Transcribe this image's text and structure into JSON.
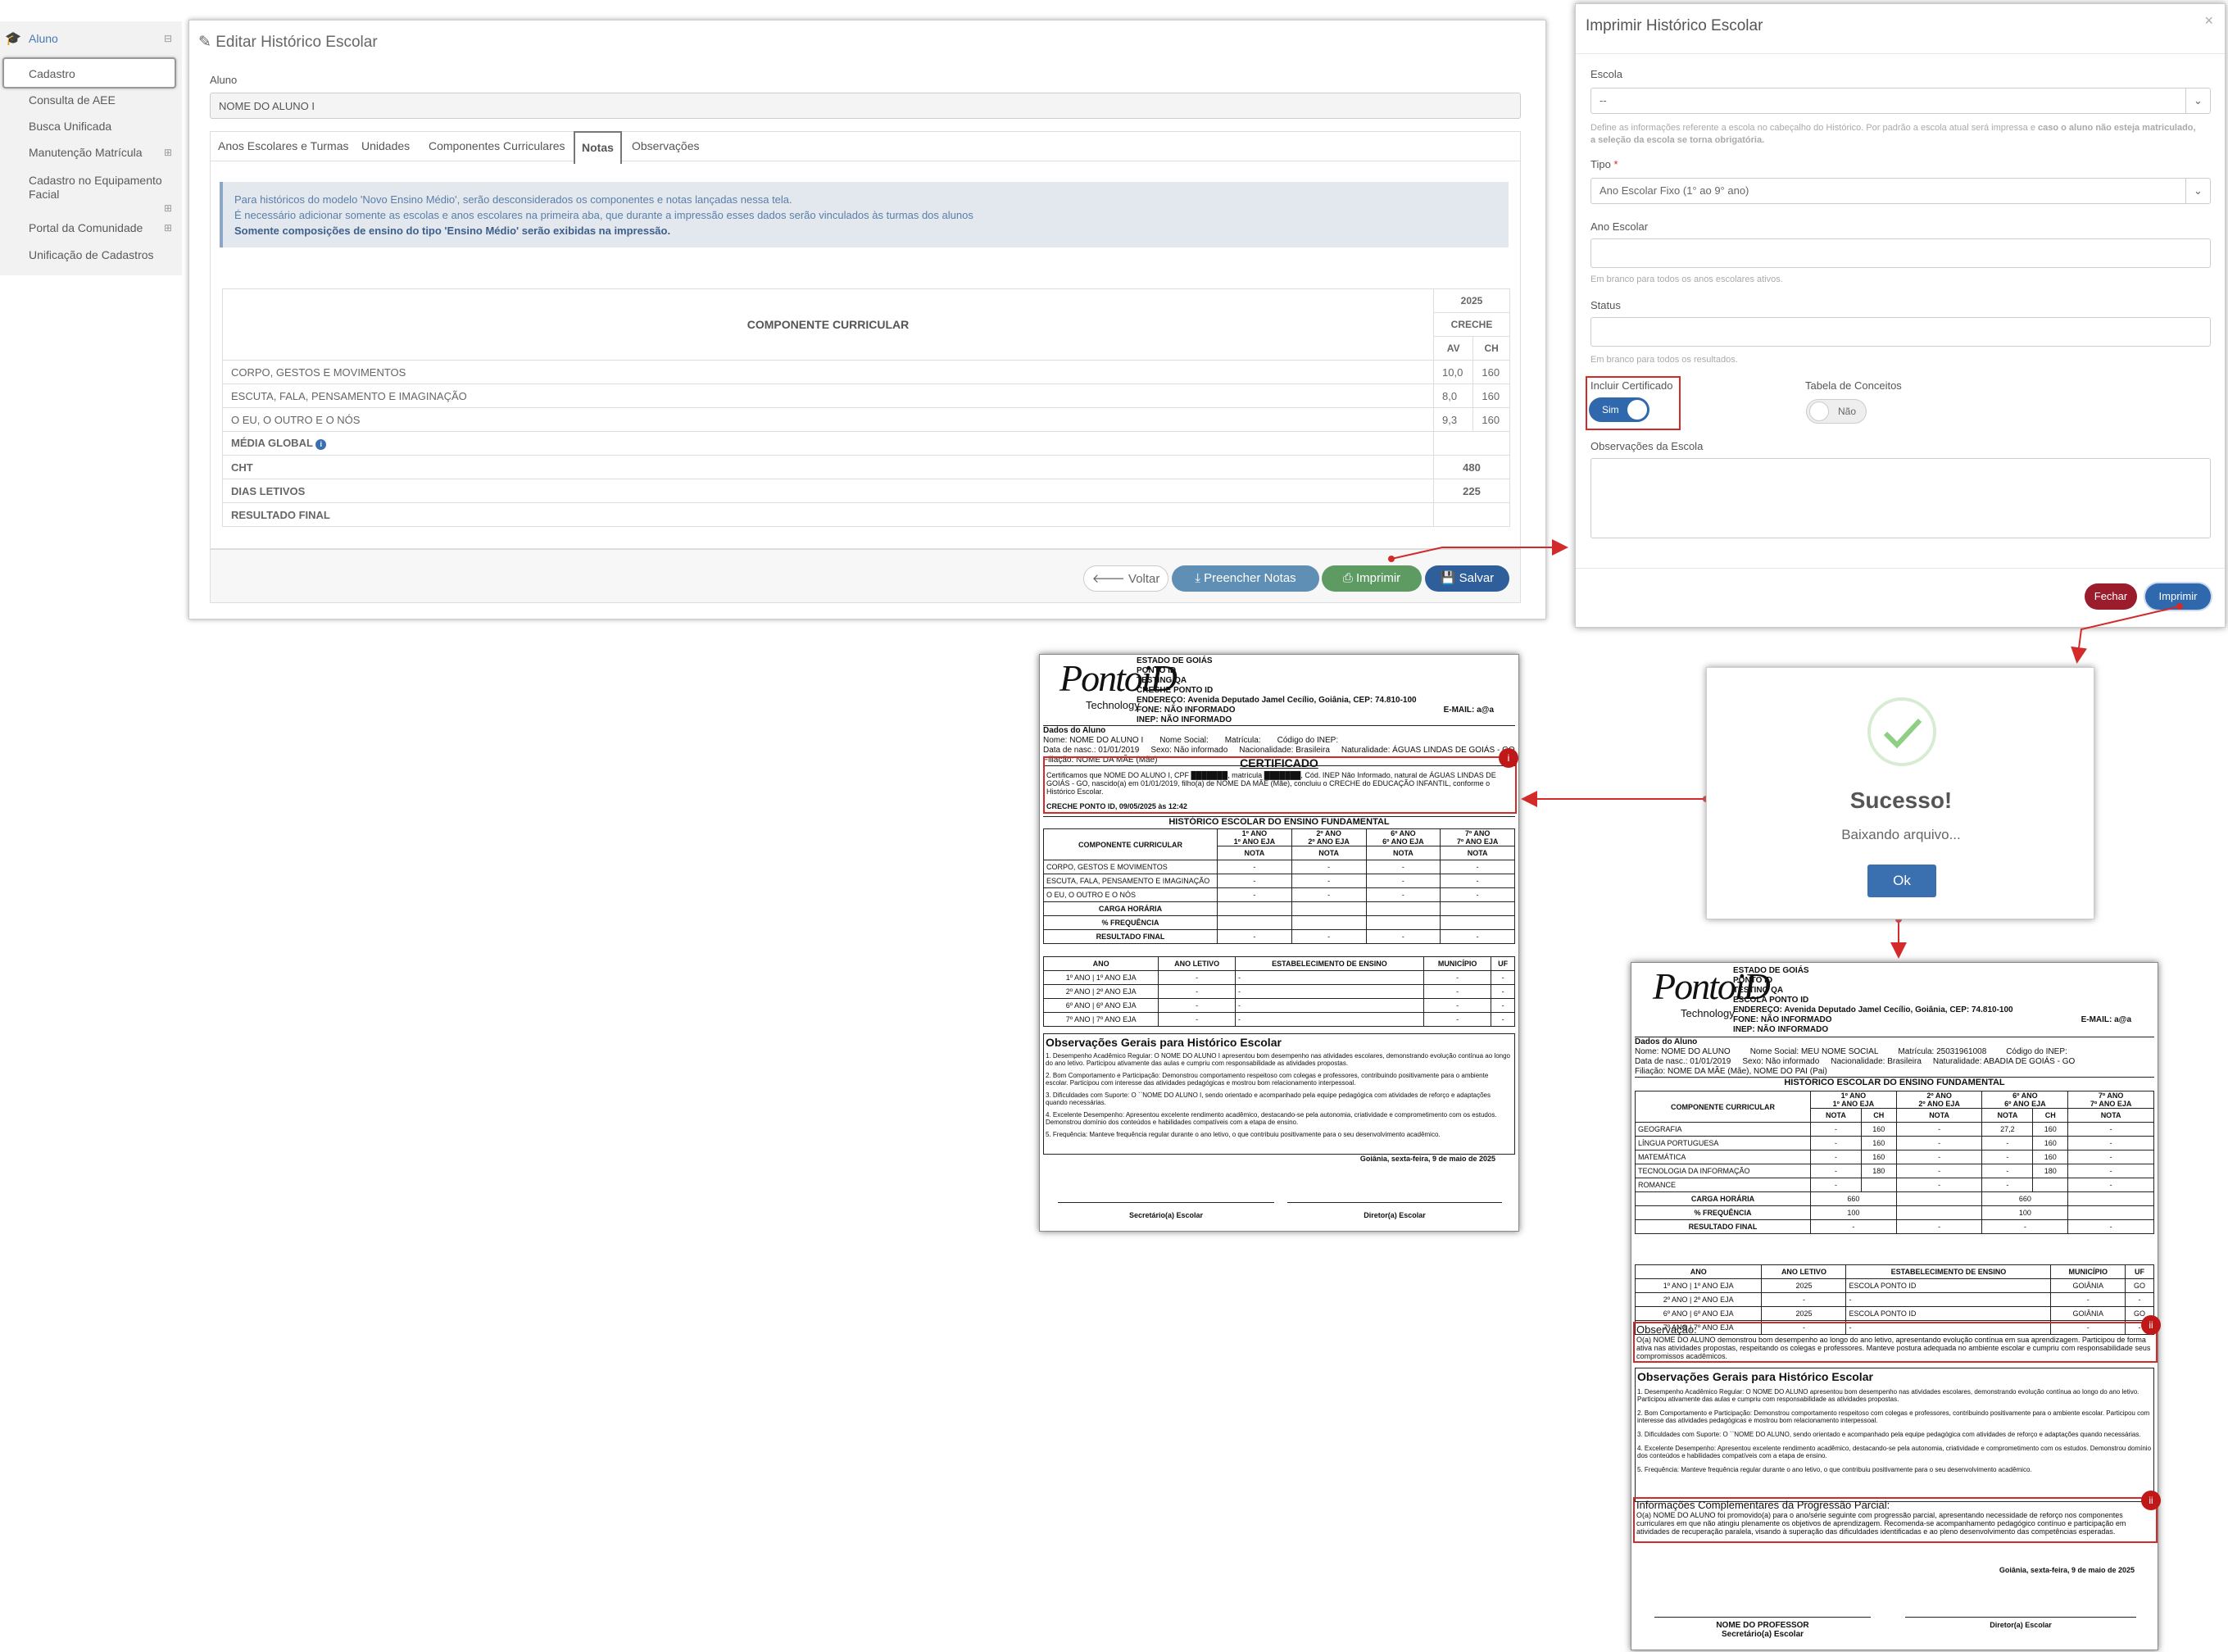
{
  "sidebar": {
    "header": "Aluno",
    "items": [
      "Cadastro",
      "Consulta de AEE",
      "Busca Unificada",
      "Manutenção Matrícula",
      "Cadastro no Equipamento Facial",
      "Portal da Comunidade",
      "Unificação de Cadastros"
    ]
  },
  "main": {
    "title": "Editar Histórico Escolar",
    "aluno_label": "Aluno",
    "aluno_value": "NOME DO ALUNO I",
    "tabs": [
      "Anos Escolares e Turmas",
      "Unidades",
      "Componentes Curriculares",
      "Notas",
      "Observações"
    ],
    "info": [
      "Para históricos do modelo 'Novo Ensino Médio', serão desconsiderados os componentes e notas lançadas nessa tela.",
      "É necessário adicionar somente as escolas e anos escolares na primeira aba, que durante a impressão esses dados serão vinculados às turmas dos alunos",
      "Somente composições de ensino do tipo 'Ensino Médio' serão exibidas na impressão."
    ],
    "table": {
      "comp_header": "COMPONENTE CURRICULAR",
      "year": "2025",
      "level": "CRECHE",
      "av": "AV",
      "ch": "CH",
      "rows": [
        {
          "name": "CORPO, GESTOS E MOVIMENTOS",
          "av": "10,0",
          "ch": "160"
        },
        {
          "name": "ESCUTA, FALA, PENSAMENTO E IMAGINAÇÃO",
          "av": "8,0",
          "ch": "160"
        },
        {
          "name": "O EU, O OUTRO E O NÓS",
          "av": "9,3",
          "ch": "160"
        }
      ],
      "media": "MÉDIA GLOBAL",
      "cht": "CHT",
      "cht_val": "480",
      "dias": "DIAS LETIVOS",
      "dias_val": "225",
      "resultado": "RESULTADO FINAL"
    },
    "buttons": {
      "voltar": "Voltar",
      "preencher": "Preencher Notas",
      "imprimir": "Imprimir",
      "salvar": "Salvar"
    }
  },
  "modal": {
    "title": "Imprimir Histórico Escolar",
    "escola_label": "Escola",
    "escola_value": "--",
    "escola_hint_a": "Define as informações referente a escola no cabeçalho do Histórico. Por padrão a escola atual será impressa e ",
    "escola_hint_b": "caso o aluno não esteja matriculado, a seleção da escola se torna obrigatória.",
    "tipo_label": "Tipo",
    "tipo_value": "Ano Escolar Fixo (1° ao 9° ano)",
    "ano_label": "Ano Escolar",
    "ano_hint": "Em branco para todos os anos escolares ativos.",
    "status_label": "Status",
    "status_hint": "Em branco para todos os resultados.",
    "cert_label": "Incluir Certificado",
    "cert_value": "Sim",
    "conceitos_label": "Tabela de Conceitos",
    "conceitos_value": "Não",
    "obs_label": "Observações da Escola",
    "fechar": "Fechar",
    "imprimir": "Imprimir",
    "close": "×"
  },
  "success": {
    "title": "Sucesso!",
    "message": "Baixando arquivo...",
    "ok": "Ok"
  },
  "doc1": {
    "logo": "PontoiD",
    "logo_sub": "Technology",
    "header": [
      "ESTADO DE GOIÁS",
      "PONTO ID",
      "TESTING QA",
      "CRECHE PONTO ID",
      "ENDEREÇO: Avenida Deputado Jamel Cecílio, Goiânia, CEP: 74.810-100",
      "FONE: NÃO INFORMADO",
      "INEP: NÃO INFORMADO"
    ],
    "email": "E-MAIL: a@a",
    "dados": [
      "Dados do Aluno",
      "Nome: NOME DO ALUNO I",
      "Nome Social:",
      "Matrícula:",
      "Código do INEP:",
      "Data de nasc.: 01/01/2019",
      "Sexo: Não informado",
      "Nacionalidade: Brasileira",
      "Naturalidade: ÁGUAS LINDAS DE GOIÁS - GO",
      "Filiação: NOME DA MÃE (Mãe)"
    ],
    "cert_title": "CERTIFICADO",
    "cert_text": "Certificamos que NOME DO ALUNO I, CPF ███████, matrícula ███████, Cód. INEP Não Informado, natural de ÁGUAS LINDAS DE GOIÁS - GO, nascido(a) em 01/01/2019, filho(a) de NOME DA MÃE (Mãe), concluiu o CRECHE do EDUCAÇÃO INFANTIL, conforme o Histórico Escolar.",
    "cert_sign": "CRECHE PONTO ID, 09/05/2025 às 12:42",
    "hist_title": "HISTÓRICO ESCOLAR DO ENSINO FUNDAMENTAL",
    "comp": "COMPONENTE CURRICULAR",
    "cols": [
      "1º ANO\n1º ANO EJA",
      "2º ANO\n2º ANO EJA",
      "6º ANO\n6º ANO EJA",
      "7º ANO\n7º ANO EJA"
    ],
    "nota": "NOTA",
    "rows": [
      "CORPO, GESTOS E MOVIMENTOS",
      "ESCUTA, FALA, PENSAMENTO E IMAGINAÇÃO",
      "O EU, O OUTRO E O NÓS"
    ],
    "sum_rows": [
      "CARGA HORÁRIA",
      "% FREQUÊNCIA",
      "RESULTADO FINAL"
    ],
    "dash": "-",
    "anos_head": [
      "ANO",
      "ANO LETIVO",
      "ESTABELECIMENTO DE ENSINO",
      "MUNICÍPIO",
      "UF"
    ],
    "anos": [
      "1º ANO | 1º ANO EJA",
      "2º ANO | 2º ANO EJA",
      "6º ANO | 6º ANO EJA",
      "7º ANO | 7º ANO EJA"
    ],
    "obs_title": "Observações Gerais para Histórico Escolar",
    "obs": [
      "1. Desempenho Acadêmico Regular: O NOME DO ALUNO I apresentou bom desempenho nas atividades escolares, demonstrando evolução contínua ao longo do ano letivo. Participou ativamente das aulas e cumpriu com responsabilidade as atividades propostas.",
      "2. Bom Comportamento e Participação: Demonstrou comportamento respeitoso com colegas e professores, contribuindo positivamente para o ambiente escolar. Participou com interesse das atividades pedagógicas e mostrou bom relacionamento interpessoal.",
      "3. Dificuldades com Suporte: O ``NOME DO ALUNO I, sendo orientado e acompanhado pela equipe pedagógica com atividades de reforço e adaptações quando necessárias.",
      "4. Excelente Desempenho: Apresentou excelente rendimento acadêmico, destacando-se pela autonomia, criatividade e comprometimento com os estudos. Demonstrou domínio dos conteúdos e habilidades compatíveis com a etapa de ensino.",
      "5. Frequência: Manteve frequência regular durante o ano letivo, o que contribuiu positivamente para o seu desenvolvimento acadêmico."
    ],
    "date": "Goiânia, sexta-feira, 9 de maio de 2025",
    "sig1": "Secretário(a) Escolar",
    "sig2": "Diretor(a) Escolar",
    "badge": "i"
  },
  "doc2": {
    "logo": "PontoiD",
    "logo_sub": "Technology",
    "header": [
      "ESTADO DE GOIÁS",
      "PONTO ID",
      "TESTING QA",
      "ESCOLA PONTO ID",
      "ENDEREÇO: Avenida Deputado Jamel Cecílio, Goiânia, CEP: 74.810-100",
      "FONE: NÃO INFORMADO",
      "INEP: NÃO INFORMADO"
    ],
    "email": "E-MAIL: a@a",
    "dados": [
      "Dados do Aluno",
      "Nome: NOME DO ALUNO",
      "Nome Social: MEU NOME SOCIAL",
      "Matrícula: 25031961008",
      "Código do INEP:",
      "Data de nasc.: 01/01/2019",
      "Sexo: Não informado",
      "Nacionalidade: Brasileira",
      "Naturalidade: ABADIA DE GOIÁS - GO",
      "Filiação: NOME DA MÃE (Mãe), NOME DO PAI (Pai)"
    ],
    "hist_title": "HISTÓRICO ESCOLAR DO ENSINO FUNDAMENTAL",
    "comp": "COMPONENTE CURRICULAR",
    "cols": [
      "1º ANO\n1º ANO EJA",
      "2º ANO\n2º ANO EJA",
      "6º ANO\n6º ANO EJA",
      "7º ANO\n7º ANO EJA"
    ],
    "nota": "NOTA",
    "ch": "CH",
    "rows": [
      [
        "GEOGRAFIA",
        "-",
        "160",
        "-",
        "27,2",
        "160",
        "-"
      ],
      [
        "LÍNGUA PORTUGUESA",
        "-",
        "160",
        "-",
        "-",
        "160",
        "-"
      ],
      [
        "MATEMÁTICA",
        "-",
        "160",
        "-",
        "-",
        "160",
        "-"
      ],
      [
        "TECNOLOGIA DA INFORMAÇÃO",
        "-",
        "180",
        "-",
        "-",
        "180",
        "-"
      ],
      [
        "ROMANCE",
        "-",
        "",
        "-",
        "-",
        "",
        "-"
      ]
    ],
    "sum_rows": [
      [
        "CARGA HORÁRIA",
        "660",
        "",
        "660",
        ""
      ],
      [
        "% FREQUÊNCIA",
        "100",
        "",
        "100",
        ""
      ],
      [
        "RESULTADO FINAL",
        "-",
        "-",
        "-",
        "-"
      ]
    ],
    "anos_head": [
      "ANO",
      "ANO LETIVO",
      "ESTABELECIMENTO DE ENSINO",
      "MUNICÍPIO",
      "UF"
    ],
    "anos": [
      [
        "1º ANO | 1º ANO EJA",
        "2025",
        "ESCOLA PONTO ID",
        "GOIÂNIA",
        "GO"
      ],
      [
        "2º ANO | 2º ANO EJA",
        "-",
        "-",
        "-",
        "-"
      ],
      [
        "6º ANO | 6º ANO EJA",
        "2025",
        "ESCOLA PONTO ID",
        "GOIÂNIA",
        "GO"
      ],
      [
        "7º ANO | 7º ANO EJA",
        "-",
        "-",
        "-",
        "-"
      ]
    ],
    "obs_head": "Observação:",
    "obs_text": "O(a) NOME DO ALUNO demonstrou bom desempenho ao longo do ano letivo, apresentando evolução contínua em sua aprendizagem. Participou de forma ativa nas atividades propostas, respeitando os colegas e professores. Manteve postura adequada no ambiente escolar e cumpriu com responsabilidade seus compromissos acadêmicos.",
    "obs_title": "Observações Gerais para Histórico Escolar",
    "obs": [
      "1. Desempenho Acadêmico Regular: O NOME DO ALUNO apresentou bom desempenho nas atividades escolares, demonstrando evolução contínua ao longo do ano letivo. Participou ativamente das aulas e cumpriu com responsabilidade as atividades propostas.",
      "2. Bom Comportamento e Participação: Demonstrou comportamento respeitoso com colegas e professores, contribuindo positivamente para o ambiente escolar. Participou com interesse das atividades pedagógicas e mostrou bom relacionamento interpessoal.",
      "3. Dificuldades com Suporte: O ``NOME DO ALUNO, sendo orientado e acompanhado pela equipe pedagógica com atividades de reforço e adaptações quando necessárias.",
      "4. Excelente Desempenho: Apresentou excelente rendimento acadêmico, destacando-se pela autonomia, criatividade e comprometimento com os estudos. Demonstrou domínio dos conteúdos e habilidades compatíveis com a etapa de ensino.",
      "5. Frequência: Manteve frequência regular durante o ano letivo, o que contribuiu positivamente para o seu desenvolvimento acadêmico."
    ],
    "comp_head": "Informações Complementares da Progressão Parcial:",
    "comp_text": "O(a) NOME DO ALUNO foi promovido(a) para o ano/série seguinte com progressão parcial, apresentando necessidade de reforço nos componentes curriculares em que não atingiu plenamente os objetivos de aprendizagem. Recomenda-se acompanhamento pedagógico contínuo e participação em atividades de recuperação paralela, visando à superação das dificuldades identificadas e ao pleno desenvolvimento das competências esperadas.",
    "date": "Goiânia, sexta-feira, 9 de maio de 2025",
    "sig1_name": "NOME DO PROFESSOR",
    "sig1": "Secretário(a) Escolar",
    "sig2": "Diretor(a) Escolar",
    "badge": "ii"
  },
  "colors": {
    "primary": "#3a6fb0",
    "success": "#5e9b63",
    "danger": "#9b1c2c",
    "red": "#d32a2a"
  }
}
